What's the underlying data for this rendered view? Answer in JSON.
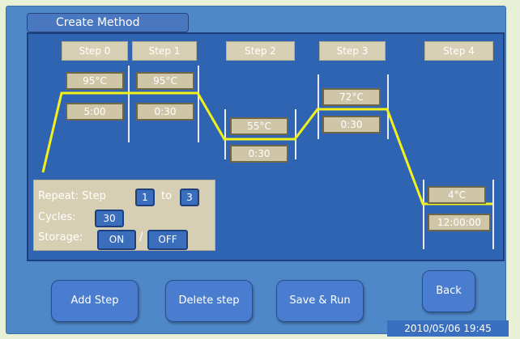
{
  "window": {
    "title": "Create Method"
  },
  "steps": [
    {
      "label": "Step 0",
      "temp": "95°C",
      "time": "5:00"
    },
    {
      "label": "Step 1",
      "temp": "95°C",
      "time": "0:30"
    },
    {
      "label": "Step 2",
      "temp": "55°C",
      "time": "0:30"
    },
    {
      "label": "Step 3",
      "temp": "72°C",
      "time": "0:30"
    },
    {
      "label": "Step 4",
      "temp": "4°C",
      "time": "12:00:00"
    }
  ],
  "repeat": {
    "label": "Repeat: Step",
    "from": "1",
    "to_label": "to",
    "to": "3",
    "cycles_label": "Cycles:",
    "cycles": "30",
    "storage_label": "Storage:",
    "on_label": "ON",
    "slash": "/",
    "off_label": "OFF"
  },
  "buttons": {
    "add_step": "Add Step",
    "delete_step": "Delete step",
    "save_run": "Save & Run",
    "back": "Back"
  },
  "status": {
    "datetime": "2010/05/06  19:45"
  },
  "colors": {
    "curve": "#f2f21a",
    "panel": "#4f88c9",
    "plot": "#2f64b3"
  }
}
